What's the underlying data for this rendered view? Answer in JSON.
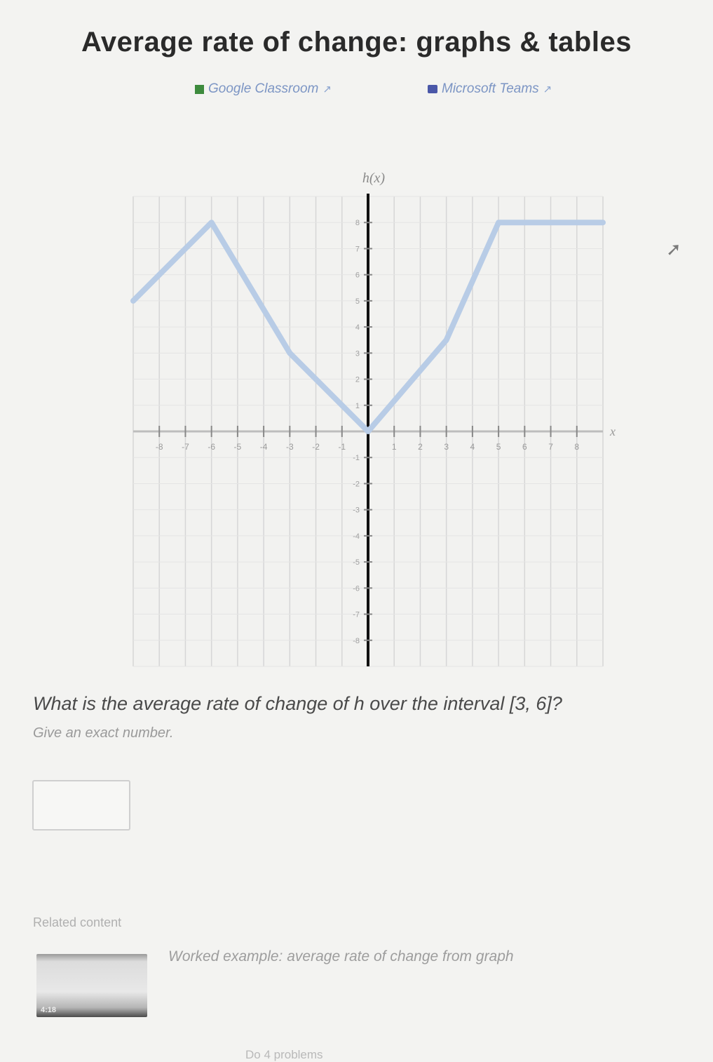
{
  "page": {
    "title": "Average rate of change: graphs & tables",
    "share": {
      "google_classroom": "Google Classroom",
      "microsoft_teams": "Microsoft Teams"
    }
  },
  "graph": {
    "y_axis_label": "h(x)",
    "x_axis_label": "x",
    "x_range": [
      -9,
      9
    ],
    "y_range": [
      -9,
      9
    ],
    "grid": true,
    "curve_color": "#b8cce6",
    "x_ticks": [
      -8,
      -7,
      -6,
      -5,
      -4,
      -3,
      -2,
      -1,
      1,
      2,
      3,
      4,
      5,
      6,
      7,
      8
    ],
    "y_ticks": [
      -8,
      -7,
      -6,
      -5,
      -4,
      -3,
      -2,
      -1,
      1,
      2,
      3,
      4,
      5,
      6,
      7,
      8
    ],
    "points": [
      [
        -9,
        5
      ],
      [
        -6,
        8
      ],
      [
        -3,
        3
      ],
      [
        0,
        0
      ],
      [
        3,
        3.5
      ],
      [
        5,
        8
      ],
      [
        9,
        8
      ]
    ]
  },
  "question": {
    "text": "What is the average rate of change of h over the interval [3, 6]?",
    "hint": "Give an exact number.",
    "answer_value": ""
  },
  "related": {
    "heading": "Related content",
    "video_title": "Worked example: average rate of change from graph",
    "video_duration": "4:18"
  },
  "footer": {
    "text": "Do 4 problems"
  }
}
